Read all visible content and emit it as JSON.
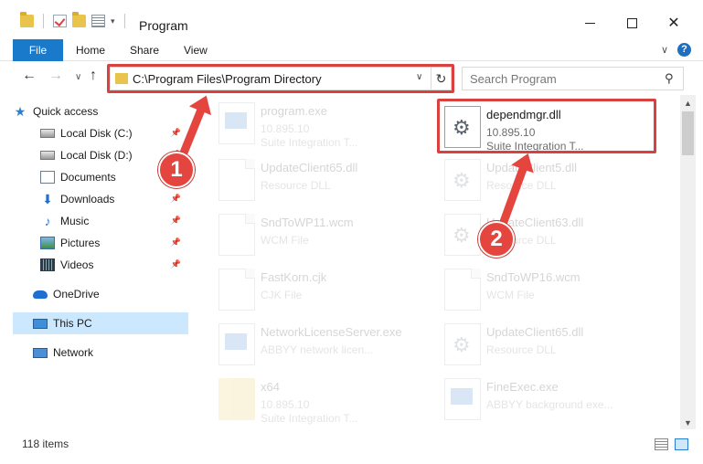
{
  "window": {
    "title": "Program",
    "controls": {
      "minimize": "Minimize",
      "maximize": "Maximize",
      "close": "✕"
    }
  },
  "ribbon": {
    "tabs": [
      "File",
      "Home",
      "Share",
      "View"
    ],
    "help": "?"
  },
  "navigation": {
    "address": "C:\\Program Files\\Program Directory",
    "search_placeholder": "Search Program"
  },
  "sidebar": {
    "items": [
      {
        "label": "Quick access",
        "icon": "star-icon",
        "pinned": false
      },
      {
        "label": "Local Disk (C:)",
        "icon": "drive-icon",
        "pinned": true
      },
      {
        "label": "Local Disk (D:)",
        "icon": "drive-icon",
        "pinned": true
      },
      {
        "label": "Documents",
        "icon": "documents-icon",
        "pinned": true
      },
      {
        "label": "Downloads",
        "icon": "downloads-icon",
        "pinned": true
      },
      {
        "label": "Music",
        "icon": "music-icon",
        "pinned": true
      },
      {
        "label": "Pictures",
        "icon": "pictures-icon",
        "pinned": true
      },
      {
        "label": "Videos",
        "icon": "videos-icon",
        "pinned": true
      },
      {
        "label": "OneDrive",
        "icon": "onedrive-icon",
        "pinned": false
      },
      {
        "label": "This PC",
        "icon": "this-pc-icon",
        "pinned": false,
        "selected": true
      },
      {
        "label": "Network",
        "icon": "network-icon",
        "pinned": false
      }
    ]
  },
  "files": [
    {
      "name": "program.exe",
      "line2": "10.895.10",
      "line3": "Suite Integration T...",
      "icon": "exe-icon",
      "dimmed": true
    },
    {
      "name": "dependmgr.dll",
      "line2": "10.895.10",
      "line3": "Suite Integration T...",
      "icon": "gear-file-icon",
      "dimmed": false,
      "highlighted": true
    },
    {
      "name": "UpdateClient65.dll",
      "line2": "Resource DLL",
      "line3": "",
      "icon": "file-icon",
      "dimmed": true
    },
    {
      "name": "UpdateClient5.dll",
      "line2": "Resource DLL",
      "line3": "",
      "icon": "gear-file-icon",
      "dimmed": true
    },
    {
      "name": "SndToWP11.wcm",
      "line2": "WCM File",
      "line3": "",
      "icon": "file-icon",
      "dimmed": true
    },
    {
      "name": "UpdateClient63.dll",
      "line2": "Resource DLL",
      "line3": "",
      "icon": "gear-file-icon",
      "dimmed": true
    },
    {
      "name": "FastKorn.cjk",
      "line2": "CJK File",
      "line3": "",
      "icon": "file-icon",
      "dimmed": true
    },
    {
      "name": "SndToWP16.wcm",
      "line2": "WCM File",
      "line3": "",
      "icon": "file-icon",
      "dimmed": true
    },
    {
      "name": "NetworkLicenseServer.exe",
      "line2": "ABBYY network licen...",
      "line3": "",
      "icon": "exe-icon",
      "dimmed": true
    },
    {
      "name": "UpdateClient65.dll",
      "line2": "Resource DLL",
      "line3": "",
      "icon": "gear-file-icon",
      "dimmed": true
    },
    {
      "name": "x64",
      "line2": "10.895.10",
      "line3": "Suite Integration T...",
      "icon": "folder-icon",
      "dimmed": true
    },
    {
      "name": "FineExec.exe",
      "line2": "ABBYY background exe...",
      "line3": "",
      "icon": "exe-icon",
      "dimmed": true
    }
  ],
  "status": {
    "count": "118 items"
  },
  "annotations": {
    "step1": "1",
    "step2": "2"
  },
  "colors": {
    "accent": "#1979ca",
    "callout": "#e5453f",
    "selected_bg": "#cce8ff"
  }
}
